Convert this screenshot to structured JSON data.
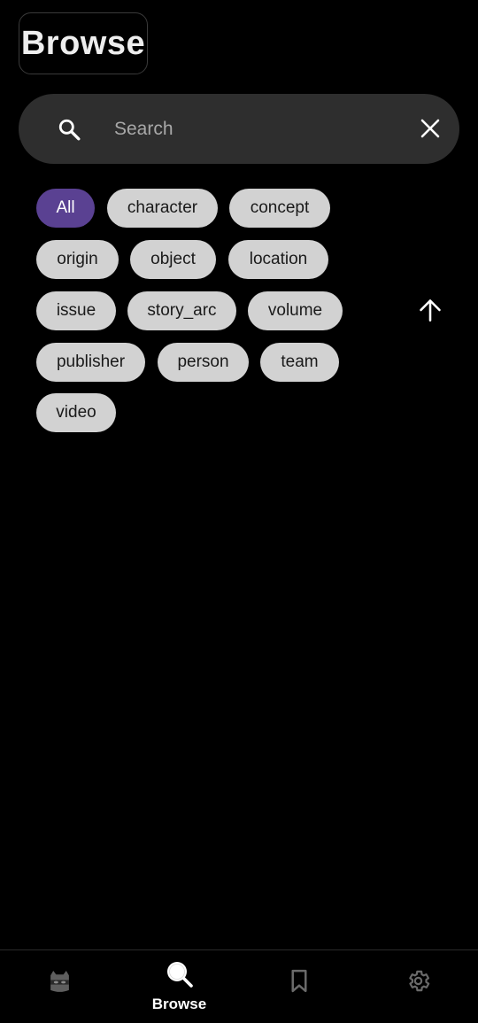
{
  "header": {
    "title": "Browse"
  },
  "search": {
    "placeholder": "Search",
    "value": ""
  },
  "filters": {
    "chips": [
      {
        "label": "All",
        "selected": true
      },
      {
        "label": "character",
        "selected": false
      },
      {
        "label": "concept",
        "selected": false
      },
      {
        "label": "origin",
        "selected": false
      },
      {
        "label": "object",
        "selected": false
      },
      {
        "label": "location",
        "selected": false
      },
      {
        "label": "issue",
        "selected": false
      },
      {
        "label": "story_arc",
        "selected": false
      },
      {
        "label": "volume",
        "selected": false
      },
      {
        "label": "publisher",
        "selected": false
      },
      {
        "label": "person",
        "selected": false
      },
      {
        "label": "team",
        "selected": false
      },
      {
        "label": "video",
        "selected": false
      }
    ]
  },
  "bottom_nav": {
    "items": [
      {
        "icon": "mask-icon",
        "label": "",
        "active": false
      },
      {
        "icon": "search-icon",
        "label": "Browse",
        "active": true
      },
      {
        "icon": "bookmark-icon",
        "label": "",
        "active": false
      },
      {
        "icon": "gear-icon",
        "label": "",
        "active": false
      }
    ]
  },
  "colors": {
    "background": "#000000",
    "search_bg": "#2e2e2e",
    "chip_bg": "#d2d2d2",
    "chip_selected_bg": "#5a4192",
    "inactive_icon": "#6a6a6a"
  }
}
